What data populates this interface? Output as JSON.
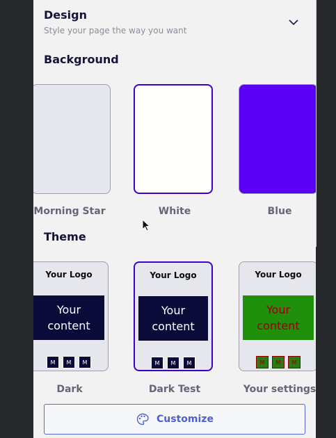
{
  "header": {
    "title": "Design",
    "subtitle": "Style your page the way you want"
  },
  "background_section": {
    "title": "Background",
    "options": [
      {
        "label": "Morning Star",
        "color": "#e5e7ec",
        "border": "#9b9fae",
        "selected": false
      },
      {
        "label": "White",
        "color": "#fffffb",
        "border": "#3b00c9",
        "selected": true
      },
      {
        "label": "Blue",
        "color": "#5b00f7",
        "border": "#9b9fae",
        "selected": false
      }
    ]
  },
  "theme_section": {
    "title": "Theme",
    "themes": [
      {
        "label": "Dark",
        "logo": "Your Logo",
        "content_line1": "Your",
        "content_line2": "content",
        "content_bg": "#0b0b3a",
        "content_color": "#ffffff",
        "squares": [
          "M",
          "M",
          "M"
        ],
        "square_bg": "#0b0b3a",
        "square_color": "#ffffff",
        "selected": false
      },
      {
        "label": "Dark Test",
        "logo": "Your Logo",
        "content_line1": "Your",
        "content_line2": "content",
        "content_bg": "#0b0b3a",
        "content_color": "#ffffff",
        "squares": [
          "M",
          "M",
          "M"
        ],
        "square_bg": "#0b0b3a",
        "square_color": "#ffffff",
        "selected": true
      },
      {
        "label": "Your settings",
        "logo": "Your Logo",
        "content_line1": "Your",
        "content_line2": "content",
        "content_bg": "#1f8f0c",
        "content_color": "#9b0000",
        "squares": [
          "M",
          "M",
          "M"
        ],
        "square_bg": "#2b7a12",
        "square_color": "#8b0000",
        "selected": false
      }
    ]
  },
  "customize_button": {
    "label": "Customize",
    "icon": "palette-icon"
  },
  "colors": {
    "accent": "#3b00c9",
    "heading": "#14143a",
    "button_text": "#4e5fd0"
  }
}
